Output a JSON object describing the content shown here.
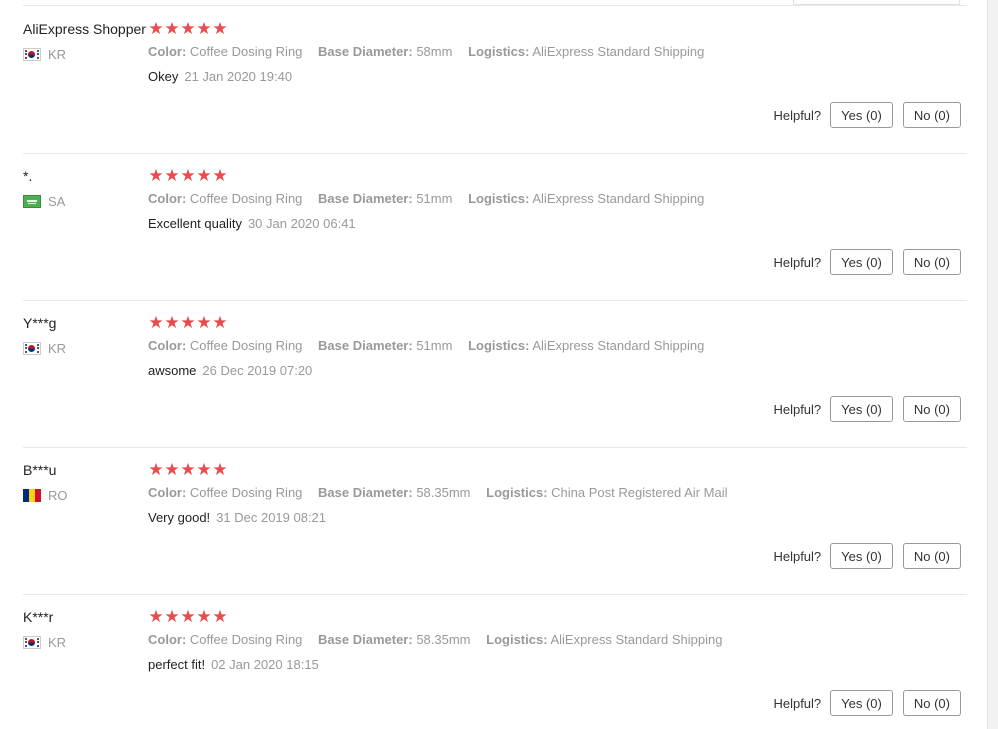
{
  "labels": {
    "color_key": "Color:",
    "diameter_key": "Base Diameter:",
    "logistics_key": "Logistics:",
    "helpful": "Helpful?",
    "star_glyph": "★"
  },
  "feedbacks": [
    {
      "user": "AliExpress Shopper",
      "country": "KR",
      "flag": "kr",
      "stars": 5,
      "color": "Coffee Dosing Ring",
      "diameter": "58mm",
      "logistics": "AliExpress Standard Shipping",
      "text": "Okey",
      "date": "21 Jan 2020 19:40",
      "yes": "Yes (0)",
      "no": "No (0)"
    },
    {
      "user": "*.",
      "country": "SA",
      "flag": "sa",
      "stars": 5,
      "color": "Coffee Dosing Ring",
      "diameter": "51mm",
      "logistics": "AliExpress Standard Shipping",
      "text": "Excellent quality",
      "date": "30 Jan 2020 06:41",
      "yes": "Yes (0)",
      "no": "No (0)"
    },
    {
      "user": "Y***g",
      "country": "KR",
      "flag": "kr",
      "stars": 5,
      "color": "Coffee Dosing Ring",
      "diameter": "51mm",
      "logistics": "AliExpress Standard Shipping",
      "text": "awsome",
      "date": "26 Dec 2019 07:20",
      "yes": "Yes (0)",
      "no": "No (0)"
    },
    {
      "user": "B***u",
      "country": "RO",
      "flag": "ro",
      "stars": 5,
      "color": "Coffee Dosing Ring",
      "diameter": "58.35mm",
      "logistics": "China Post Registered Air Mail",
      "text": "Very good!",
      "date": "31 Dec 2019 08:21",
      "yes": "Yes (0)",
      "no": "No (0)"
    },
    {
      "user": "K***r",
      "country": "KR",
      "flag": "kr",
      "stars": 5,
      "color": "Coffee Dosing Ring",
      "diameter": "58.35mm",
      "logistics": "AliExpress Standard Shipping",
      "text": "perfect fit!",
      "date": "02 Jan 2020 18:15",
      "yes": "Yes (0)",
      "no": "No (0)"
    }
  ],
  "colors": {
    "star": "#e84c4c",
    "muted_text": "#999999",
    "separator": "#e8e8e8"
  }
}
